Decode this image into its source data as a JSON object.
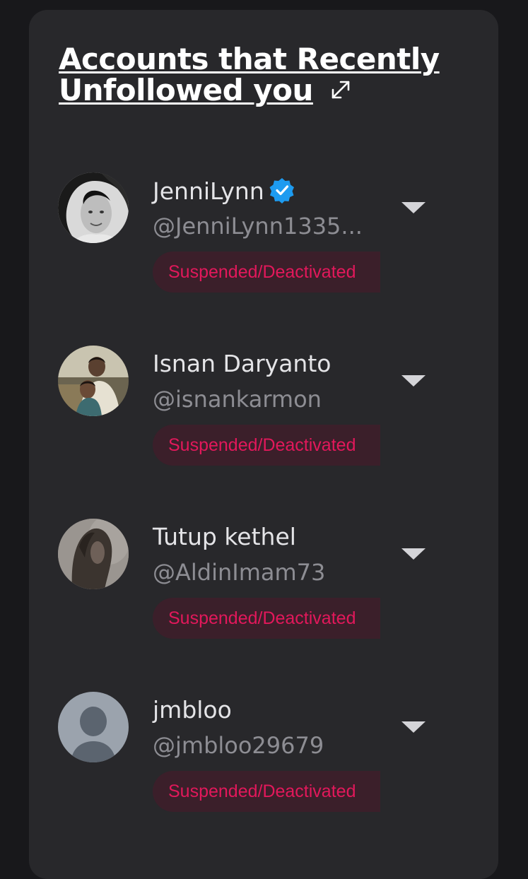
{
  "widget": {
    "title": "Accounts that Recently Unfollowed you"
  },
  "accounts": [
    {
      "name": "JenniLynn",
      "handle": "@JenniLynn1335...",
      "verified": true,
      "status": "Suspended/Deactivated"
    },
    {
      "name": "Isnan Daryanto",
      "handle": "@isnankarmon",
      "verified": false,
      "status": "Suspended/Deactivated"
    },
    {
      "name": "Tutup kethel",
      "handle": "@AldinImam73",
      "verified": false,
      "status": "Suspended/Deactivated"
    },
    {
      "name": "jmbloo",
      "handle": "@jmbloo29679",
      "verified": false,
      "status": "Suspended/Deactivated"
    }
  ],
  "colors": {
    "background": "#18181b",
    "card": "#28282b",
    "status_text": "#e2185b",
    "status_bg": "#3b1f2a",
    "verified": "#1d9bf0"
  }
}
